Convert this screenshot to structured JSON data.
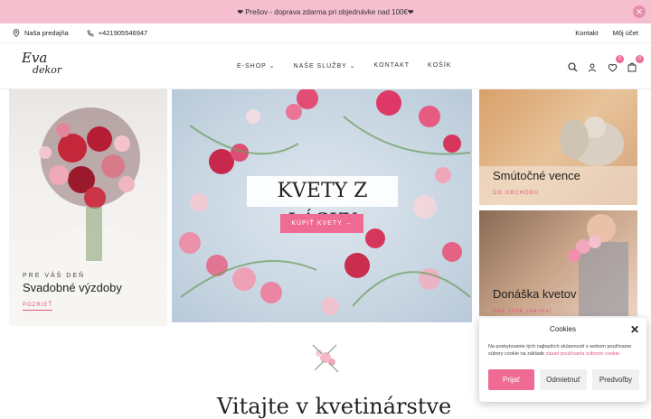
{
  "announcement": {
    "text": "❤ Prešov - doprava zdarma pri objednávke nad 100€❤",
    "close_icon": "close-icon"
  },
  "topbar": {
    "store": "Naša predajňa",
    "phone": "+421905546947",
    "contact": "Kontakt",
    "account": "Môj účet"
  },
  "header": {
    "logo_line1": "Eva",
    "logo_line2": "dekor",
    "nav": [
      "E-SHOP",
      "NAŠE SLUŽBY",
      "KONTAKT",
      "KOŠÍK"
    ],
    "wishlist_count": "0",
    "cart_count": "0"
  },
  "tiles": {
    "left": {
      "kicker": "PRE VÁŠ DEŇ",
      "title": "Svadobné výzdoby",
      "link": "POZRIEŤ"
    },
    "center": {
      "title": "KVETY Z LÁSKY",
      "button": "KÚPIŤ KVETY →"
    },
    "top_right": {
      "title": "Smútočné vence",
      "link": "DO OBCHODU"
    },
    "bottom_right": {
      "title": "Donáška kvetov",
      "link": "Nad 100€ zdarma!"
    }
  },
  "welcome": "Vitajte v kvetinárstve",
  "cookie": {
    "title": "Cookies",
    "text": "Na poskytovanie tých najlepších skúseností s webom používame súbory cookie na základe",
    "link": "zásad používania súborov cookie.",
    "accept": "Prijať",
    "reject": "Odmietnuť",
    "preferences": "Predvoľby"
  },
  "colors": {
    "accent": "#ef6b93",
    "announce_bg": "#f6bfd0"
  }
}
